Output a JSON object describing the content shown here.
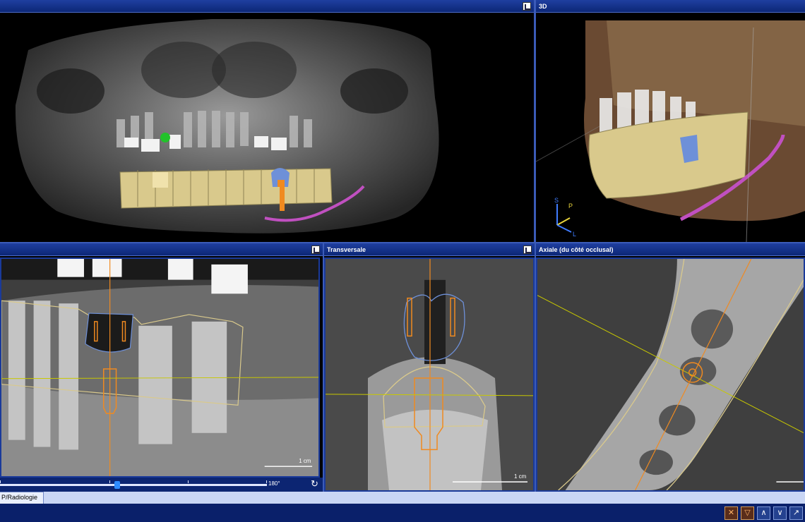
{
  "panels": {
    "panoramic": {
      "title": ""
    },
    "threed": {
      "title": "3D",
      "orientation": {
        "s": "S",
        "p": "P",
        "l": "L"
      }
    },
    "sagittal": {
      "title": "",
      "scale": "1 cm"
    },
    "transversal": {
      "title": "Transversale",
      "scale": "1 cm"
    },
    "axial": {
      "title": "Axiale (du côté occlusal)"
    }
  },
  "slider": {
    "value_label": "180°",
    "position_fraction": 0.44
  },
  "tabs": [
    {
      "label": "P/Radiologie"
    }
  ],
  "toolbar": {
    "tools": [
      {
        "icon": "crosshair-tool-icon"
      },
      {
        "icon": "implant-tool-icon"
      },
      {
        "icon": "nerve-tool-icon"
      },
      {
        "icon": "angle-tool-icon"
      },
      {
        "icon": "measure-tool-icon"
      }
    ]
  },
  "colors": {
    "title_bar": "#0c2776",
    "implant": "#f08a20",
    "crosshair": "#c8c800",
    "nerve": "#c050c0",
    "bone": "#d9c98c",
    "crown": "#6e90d8"
  }
}
